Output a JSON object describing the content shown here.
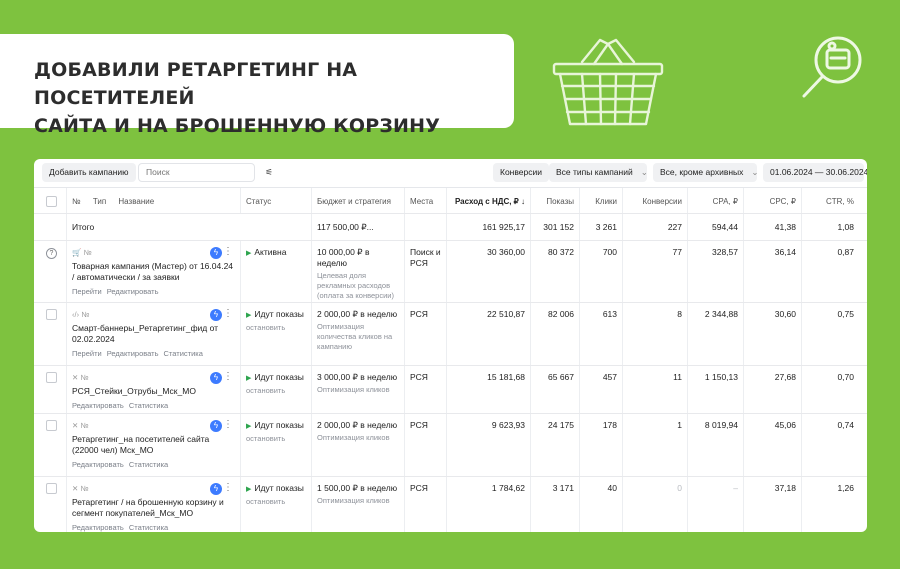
{
  "heading": {
    "line1": "ДОБАВИЛИ РЕТАРГЕТИНГ НА ПОСЕТИТЕЛЕЙ",
    "line2": "САЙТА И НА БРОШЕННУЮ КОРЗИНУ"
  },
  "toolbar": {
    "add_campaign": "Добавить кампанию",
    "search_placeholder": "Поиск",
    "conversions": "Конверсии",
    "campaign_types": "Все типы кампаний",
    "archive_filter": "Все, кроме архивных",
    "date_range": "01.06.2024 — 30.06.2024"
  },
  "columns": {
    "num": "№",
    "type": "Тип",
    "name": "Название",
    "status": "Статус",
    "budget": "Бюджет и стратегия",
    "places": "Места",
    "spend": "Расход с НДС, ₽ ↓",
    "impressions": "Показы",
    "clicks": "Клики",
    "conversions": "Конверсии",
    "cpa": "CPA, ₽",
    "cpc": "CPC, ₽",
    "ctr": "CTR, %"
  },
  "total": {
    "label": "Итого",
    "budget": "117 500,00 ₽...",
    "spend": "161 925,17",
    "impressions": "301 152",
    "clicks": "3 261",
    "conversions": "227",
    "cpa": "594,44",
    "cpc": "41,38",
    "ctr": "1,08"
  },
  "rows": [
    {
      "num": "№",
      "name": "Товарная кампания (Мастер) от 16.04.24 / автоматически / за заявки",
      "link_go": "Перейти",
      "link_edit": "Редактировать",
      "status": "Активна",
      "status_sub": "",
      "budget": "10 000,00 ₽ в неделю",
      "strategy": "Целевая доля рекламных расходов (оплата за конверсии)",
      "places": "Поиск и РСЯ",
      "spend": "30 360,00",
      "impressions": "80 372",
      "clicks": "700",
      "conversions": "77",
      "cpa": "328,57",
      "cpc": "36,14",
      "ctr": "0,87"
    },
    {
      "num": "№",
      "name": "Смарт-баннеры_Ретаргетинг_фид от 02.02.2024",
      "link_go": "Перейти",
      "link_edit": "Редактировать",
      "link_stats": "Статистика",
      "status": "Идут показы",
      "status_sub": "остановить",
      "budget": "2 000,00 ₽ в неделю",
      "strategy": "Оптимизация количества кликов на кампанию",
      "places": "РСЯ",
      "spend": "22 510,87",
      "impressions": "82 006",
      "clicks": "613",
      "conversions": "8",
      "cpa": "2 344,88",
      "cpc": "30,60",
      "ctr": "0,75"
    },
    {
      "num": "№",
      "name": "РСЯ_Стейки_Отрубы_Мск_МО",
      "link_edit": "Редактировать",
      "link_stats": "Статистика",
      "status": "Идут показы",
      "status_sub": "остановить",
      "budget": "3 000,00 ₽ в неделю",
      "strategy": "Оптимизация кликов",
      "places": "РСЯ",
      "spend": "15 181,68",
      "impressions": "65 667",
      "clicks": "457",
      "conversions": "11",
      "cpa": "1 150,13",
      "cpc": "27,68",
      "ctr": "0,70"
    },
    {
      "num": "№",
      "name": "Ретаргетинг_на посетителей сайта (22000 чел) Мск_МО",
      "link_edit": "Редактировать",
      "link_stats": "Статистика",
      "status": "Идут показы",
      "status_sub": "остановить",
      "budget": "2 000,00 ₽ в неделю",
      "strategy": "Оптимизация кликов",
      "places": "РСЯ",
      "spend": "9 623,93",
      "impressions": "24 175",
      "clicks": "178",
      "conversions": "1",
      "cpa": "8 019,94",
      "cpc": "45,06",
      "ctr": "0,74"
    },
    {
      "num": "№",
      "name": "Ретаргетинг / на брошенную корзину и сегмент покупателей_Мск_МО",
      "link_edit": "Редактировать",
      "link_stats": "Статистика",
      "status": "Идут показы",
      "status_sub": "остановить",
      "budget": "1 500,00 ₽ в неделю",
      "strategy": "Оптимизация кликов",
      "places": "РСЯ",
      "spend": "1 784,62",
      "impressions": "3 171",
      "clicks": "40",
      "conversions": "0",
      "cpa": "–",
      "cpc": "37,18",
      "ctr": "1,26"
    }
  ]
}
